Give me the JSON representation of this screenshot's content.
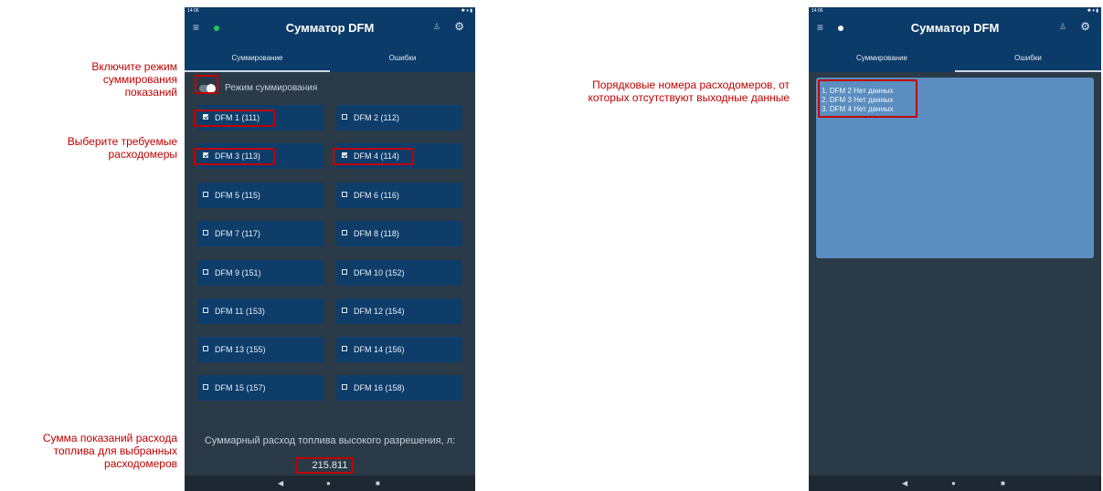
{
  "annotations": {
    "enable_mode": "Включите режим суммирования показаний",
    "select_meters": "Выберите требуемые расходомеры",
    "sum_readings": "Сумма показаний расхода топлива для выбранных расходомеров",
    "error_meters": "Порядковые номера расходомеров, от которых отсутствуют выходные данные"
  },
  "screen1": {
    "status": {
      "time": "14:06",
      "right_icons": "✱ ▾ ▮"
    },
    "app_title": "Сумматор DFM",
    "tabs": [
      {
        "label": "Суммирование",
        "active": true
      },
      {
        "label": "Ошибки",
        "active": false
      }
    ],
    "mode_toggle": {
      "label": "Режим суммирования",
      "on": true
    },
    "meters": [
      {
        "label": "DFM 1 (111)",
        "checked": true
      },
      {
        "label": "DFM 2 (112)",
        "checked": false
      },
      {
        "label": "DFM 3 (113)",
        "checked": true
      },
      {
        "label": "DFM 4 (114)",
        "checked": true
      },
      {
        "label": "DFM 5 (115)",
        "checked": false
      },
      {
        "label": "DFM 6 (116)",
        "checked": false
      },
      {
        "label": "DFM 7 (117)",
        "checked": false
      },
      {
        "label": "DFM 8 (118)",
        "checked": false
      },
      {
        "label": "DFM 9 (151)",
        "checked": false
      },
      {
        "label": "DFM 10 (152)",
        "checked": false
      },
      {
        "label": "DFM 11 (153)",
        "checked": false
      },
      {
        "label": "DFM 12 (154)",
        "checked": false
      },
      {
        "label": "DFM 13 (155)",
        "checked": false
      },
      {
        "label": "DFM 14 (156)",
        "checked": false
      },
      {
        "label": "DFM 15 (157)",
        "checked": false
      },
      {
        "label": "DFM 16 (158)",
        "checked": false
      }
    ],
    "total_label": "Суммарный расход топлива высокого разрешения, л:",
    "total_value": "215.811"
  },
  "screen2": {
    "status": {
      "time": "14:06",
      "right_icons": "✱ ▾ ▮"
    },
    "app_title": "Сумматор DFM",
    "tabs": [
      {
        "label": "Суммирование",
        "active": false
      },
      {
        "label": "Ошибки",
        "active": true
      }
    ],
    "errors": [
      "1. DFM 2 Нет данных",
      "2. DFM 3 Нет данных",
      "3. DFM 4 Нет данных"
    ]
  },
  "colors": {
    "status_dot_screen1": "#22c55e",
    "status_dot_screen2": "#ffffff",
    "annotation": "#c00000"
  }
}
